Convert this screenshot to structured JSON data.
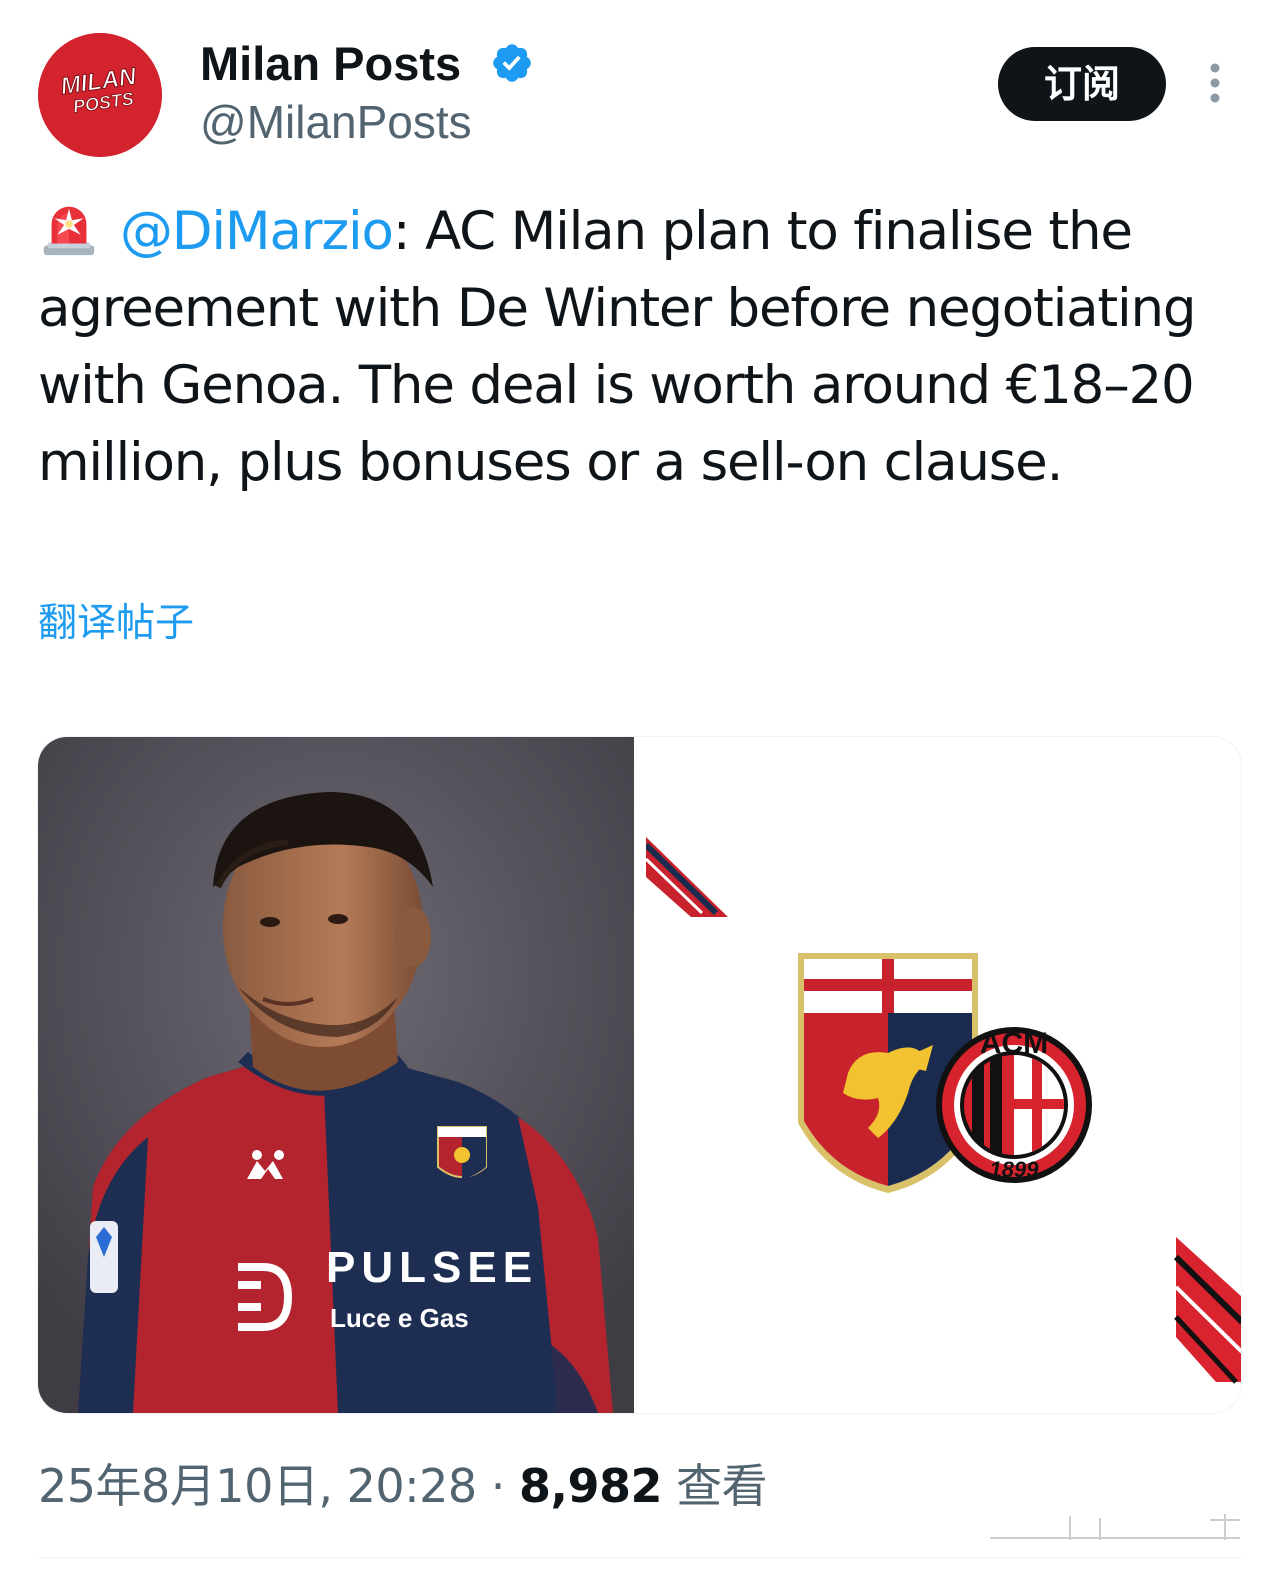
{
  "post": {
    "author": {
      "name": "Milan Posts",
      "handle": "@MilanPosts",
      "avatar_text": "MILAN POSTS",
      "avatar_color": "#d3232e",
      "verified": true,
      "verified_icon": "verified-badge-icon"
    },
    "subscribe_label": "订阅",
    "more_icon": "more-vertical-icon",
    "text": {
      "emoji": "rotating-light-siren-icon",
      "mention": "@DiMarzio",
      "body": ": AC Milan plan to finalise the agreement with De Winter before negotiating with Genoa. The deal is worth around €18–20 million, plus bonuses or a sell-on clause."
    },
    "translate_label": "翻译帖子",
    "media": {
      "left": {
        "kind": "photo",
        "jersey_sponsor": "PULSEE",
        "jersey_sponsor_sub": "Luce e Gas"
      },
      "right": {
        "kind": "club-crests",
        "crest_left": "Genoa CFC",
        "crest_right_text": "ACM",
        "crest_right_year": "1899"
      }
    },
    "timestamp": "25年8月10日, 20:28",
    "separator": " · ",
    "views": "8,982",
    "views_label": " 查看"
  },
  "colors": {
    "text_primary": "#0f1419",
    "text_secondary": "#536471",
    "link": "#1d9bf0",
    "button_bg": "#0f1419",
    "genoa_red": "#c8232c",
    "genoa_blue": "#1b2a4f",
    "milan_red": "#e0242f"
  }
}
